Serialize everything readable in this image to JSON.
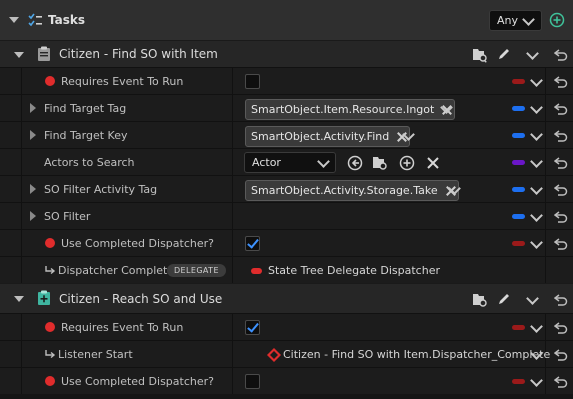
{
  "header": {
    "title": "Tasks",
    "filter_value": "Any"
  },
  "tasks": [
    {
      "title": "Citizen - Find SO with Item",
      "properties": [
        {
          "label": "Requires Event To Run",
          "value_type": "checkbox",
          "checked": false,
          "pin_color": "#9b1a1a"
        },
        {
          "label": "Find Target Tag",
          "value": "SmartObject.Item.Resource.Ingot",
          "pin_color": "#1d6ff0"
        },
        {
          "label": "Find Target Key",
          "value": "SmartObject.Activity.Find",
          "pin_color": "#1d6ff0"
        },
        {
          "label": "Actors to Search",
          "value": "Actor",
          "pin_color": "#6a16c8"
        },
        {
          "label": "SO Filter Activity Tag",
          "value": "SmartObject.Activity.Storage.Take",
          "pin_color": "#1d6ff0"
        },
        {
          "label": "SO Filter",
          "pin_color": "#1d6ff0"
        },
        {
          "label": "Use Completed Dispatcher?",
          "value_type": "checkbox",
          "checked": true,
          "pin_color": "#9b1a1a"
        },
        {
          "label": "Dispatcher Complete",
          "badge": "DELEGATE",
          "value": "State Tree Delegate Dispatcher"
        }
      ]
    },
    {
      "title": "Citizen - Reach SO and Use",
      "properties": [
        {
          "label": "Requires Event To Run",
          "value_type": "checkbox",
          "checked": true,
          "pin_color": "#9b1a1a"
        },
        {
          "label": "Listener Start",
          "value": "Citizen - Find SO with Item.Dispatcher_Complete"
        },
        {
          "label": "Use Completed Dispatcher?",
          "value_type": "checkbox",
          "checked": false,
          "pin_color": "#9b1a1a"
        }
      ]
    }
  ]
}
